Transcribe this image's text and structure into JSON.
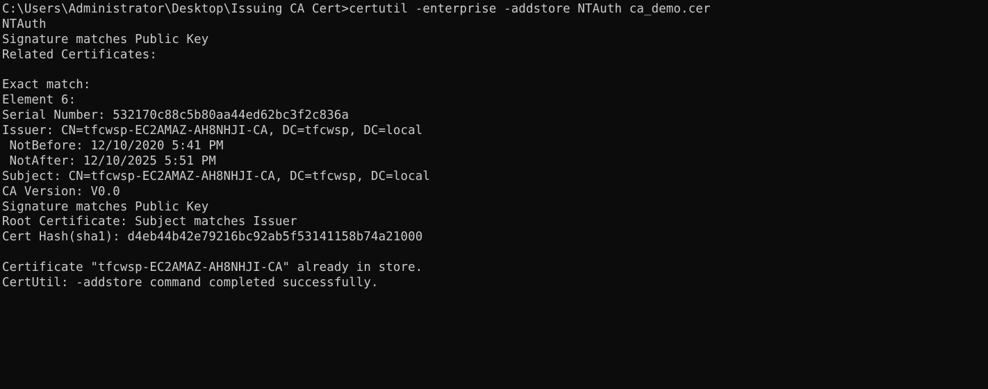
{
  "console": {
    "lines": [
      "C:\\Users\\Administrator\\Desktop\\Issuing CA Cert>certutil -enterprise -addstore NTAuth ca_demo.cer",
      "NTAuth",
      "Signature matches Public Key",
      "Related Certificates:",
      "",
      "Exact match:",
      "Element 6:",
      "Serial Number: 532170c88c5b80aa44ed62bc3f2c836a",
      "Issuer: CN=tfcwsp-EC2AMAZ-AH8NHJI-CA, DC=tfcwsp, DC=local",
      " NotBefore: 12/10/2020 5:41 PM",
      " NotAfter: 12/10/2025 5:51 PM",
      "Subject: CN=tfcwsp-EC2AMAZ-AH8NHJI-CA, DC=tfcwsp, DC=local",
      "CA Version: V0.0",
      "Signature matches Public Key",
      "Root Certificate: Subject matches Issuer",
      "Cert Hash(sha1): d4eb44b42e79216bc92ab5f53141158b74a21000",
      "",
      "Certificate \"tfcwsp-EC2AMAZ-AH8NHJI-CA\" already in store.",
      "CertUtil: -addstore command completed successfully."
    ]
  },
  "colors": {
    "background": "#0c0c0c",
    "text": "#cccccc"
  }
}
